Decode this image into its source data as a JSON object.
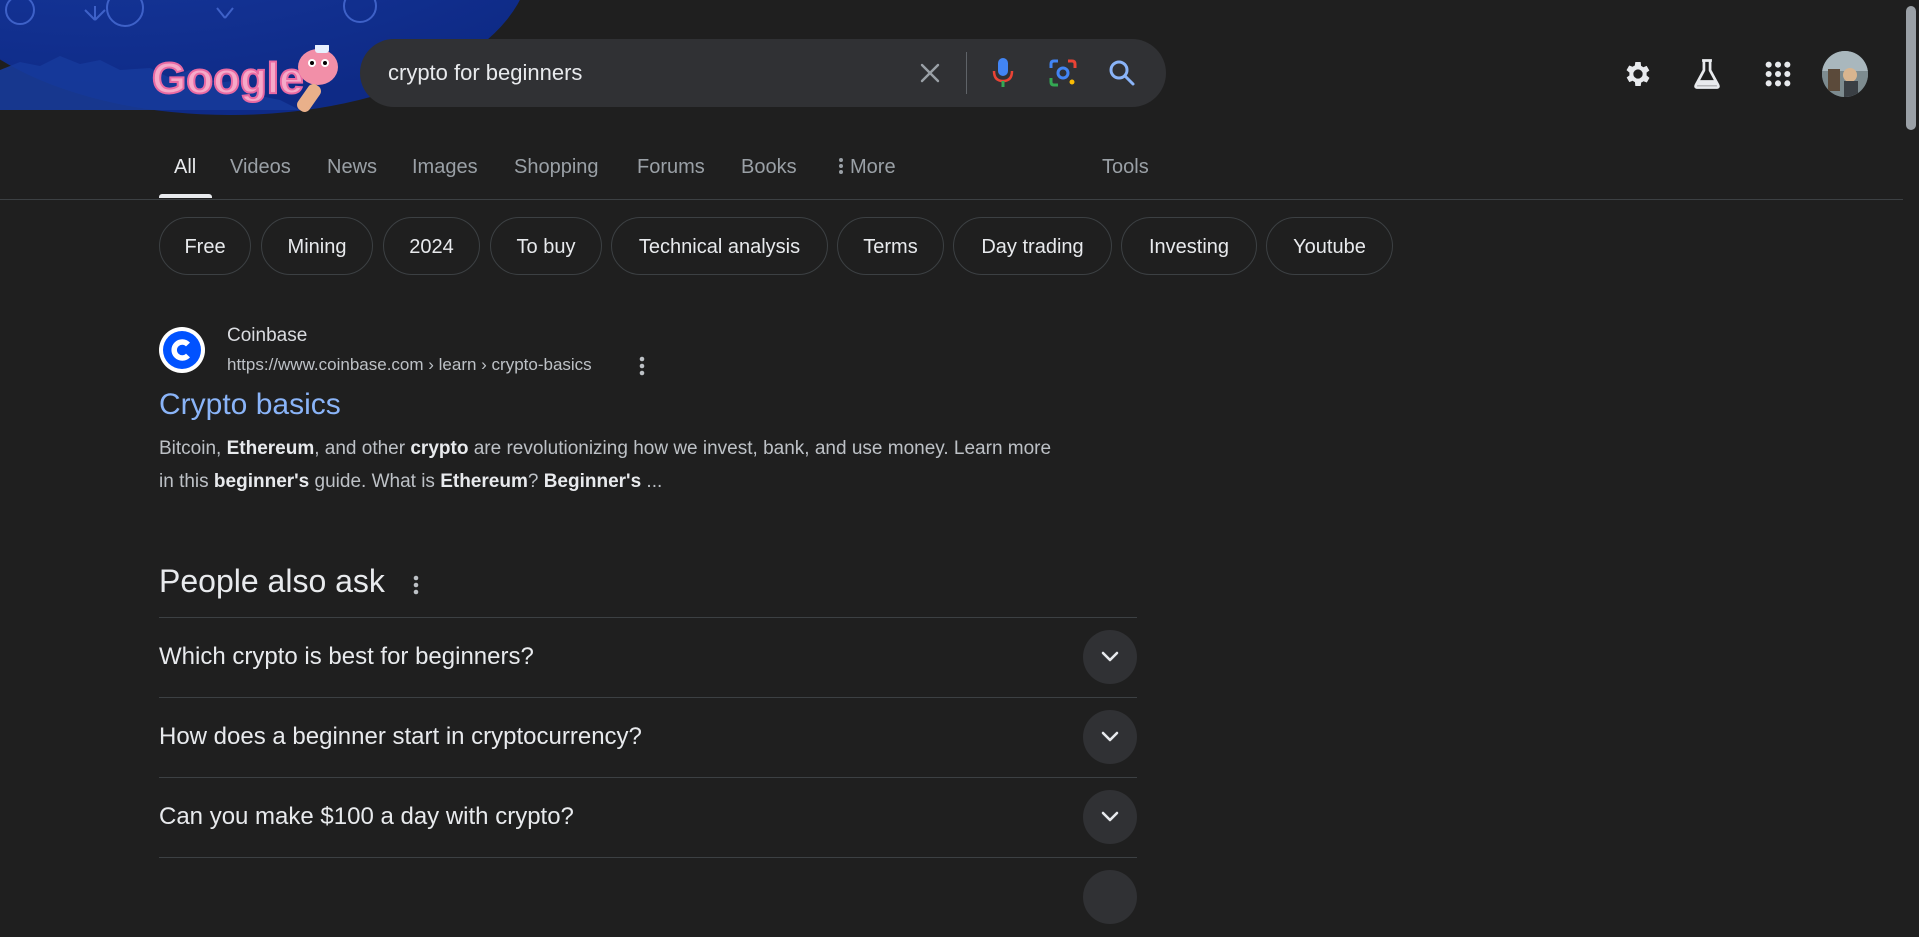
{
  "logo": {
    "text": "Google"
  },
  "search": {
    "query": "crypto for beginners"
  },
  "header_icons": [
    "settings-gear-icon",
    "labs-flask-icon",
    "apps-grid-icon",
    "avatar"
  ],
  "tabs": [
    {
      "label": "All",
      "active": true
    },
    {
      "label": "Videos"
    },
    {
      "label": "News"
    },
    {
      "label": "Images"
    },
    {
      "label": "Shopping"
    },
    {
      "label": "Forums"
    },
    {
      "label": "Books"
    },
    {
      "label": "More"
    },
    {
      "label": "Tools"
    }
  ],
  "chips": [
    "Free",
    "Mining",
    "2024",
    "To buy",
    "Technical analysis",
    "Terms",
    "Day trading",
    "Investing",
    "Youtube"
  ],
  "result": {
    "site_name": "Coinbase",
    "url": "https://www.coinbase.com › learn › crypto-basics",
    "title": "Crypto basics",
    "snippet_parts": [
      {
        "t": "Bitcoin, "
      },
      {
        "t": "Ethereum",
        "b": true
      },
      {
        "t": ", and other "
      },
      {
        "t": "crypto",
        "b": true
      },
      {
        "t": " are revolutionizing how we invest, bank, and use money. Learn more in this "
      },
      {
        "t": "beginner's",
        "b": true
      },
      {
        "t": " guide. What is "
      },
      {
        "t": "Ethereum",
        "b": true
      },
      {
        "t": "? "
      },
      {
        "t": "Beginner's",
        "b": true
      },
      {
        "t": " ..."
      }
    ]
  },
  "paa": {
    "title": "People also ask",
    "questions": [
      "Which crypto is best for beginners?",
      "How does a beginner start in cryptocurrency?",
      "Can you make $100 a day with crypto?"
    ]
  },
  "colors": {
    "background": "#1f1f1f",
    "link": "#8ab4f8",
    "chip_border": "#3c4043",
    "search_box": "#303134"
  }
}
